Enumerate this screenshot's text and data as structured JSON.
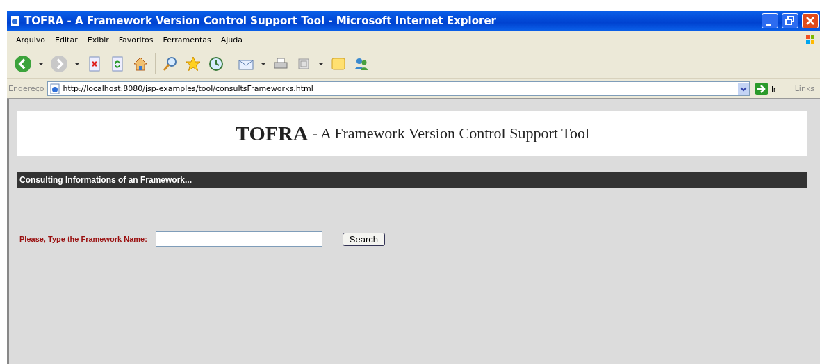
{
  "window": {
    "title": "TOFRA - A Framework Version Control Support Tool - Microsoft Internet Explorer"
  },
  "menu": [
    "Arquivo",
    "Editar",
    "Exibir",
    "Favoritos",
    "Ferramentas",
    "Ajuda"
  ],
  "address_bar": {
    "label": "Endereço",
    "url": "http://localhost:8080/jsp-examples/tool/consultsFrameworks.html",
    "go_button": "Ir",
    "links": "Links"
  },
  "page": {
    "heading": "**TOFRA** - A Framework Version Control Support Tool",
    "section_bar": "Consulting Informations of an Framework...",
    "form": {
      "label": "Please, Type the Framework Name:",
      "button": "Search"
    }
  }
}
